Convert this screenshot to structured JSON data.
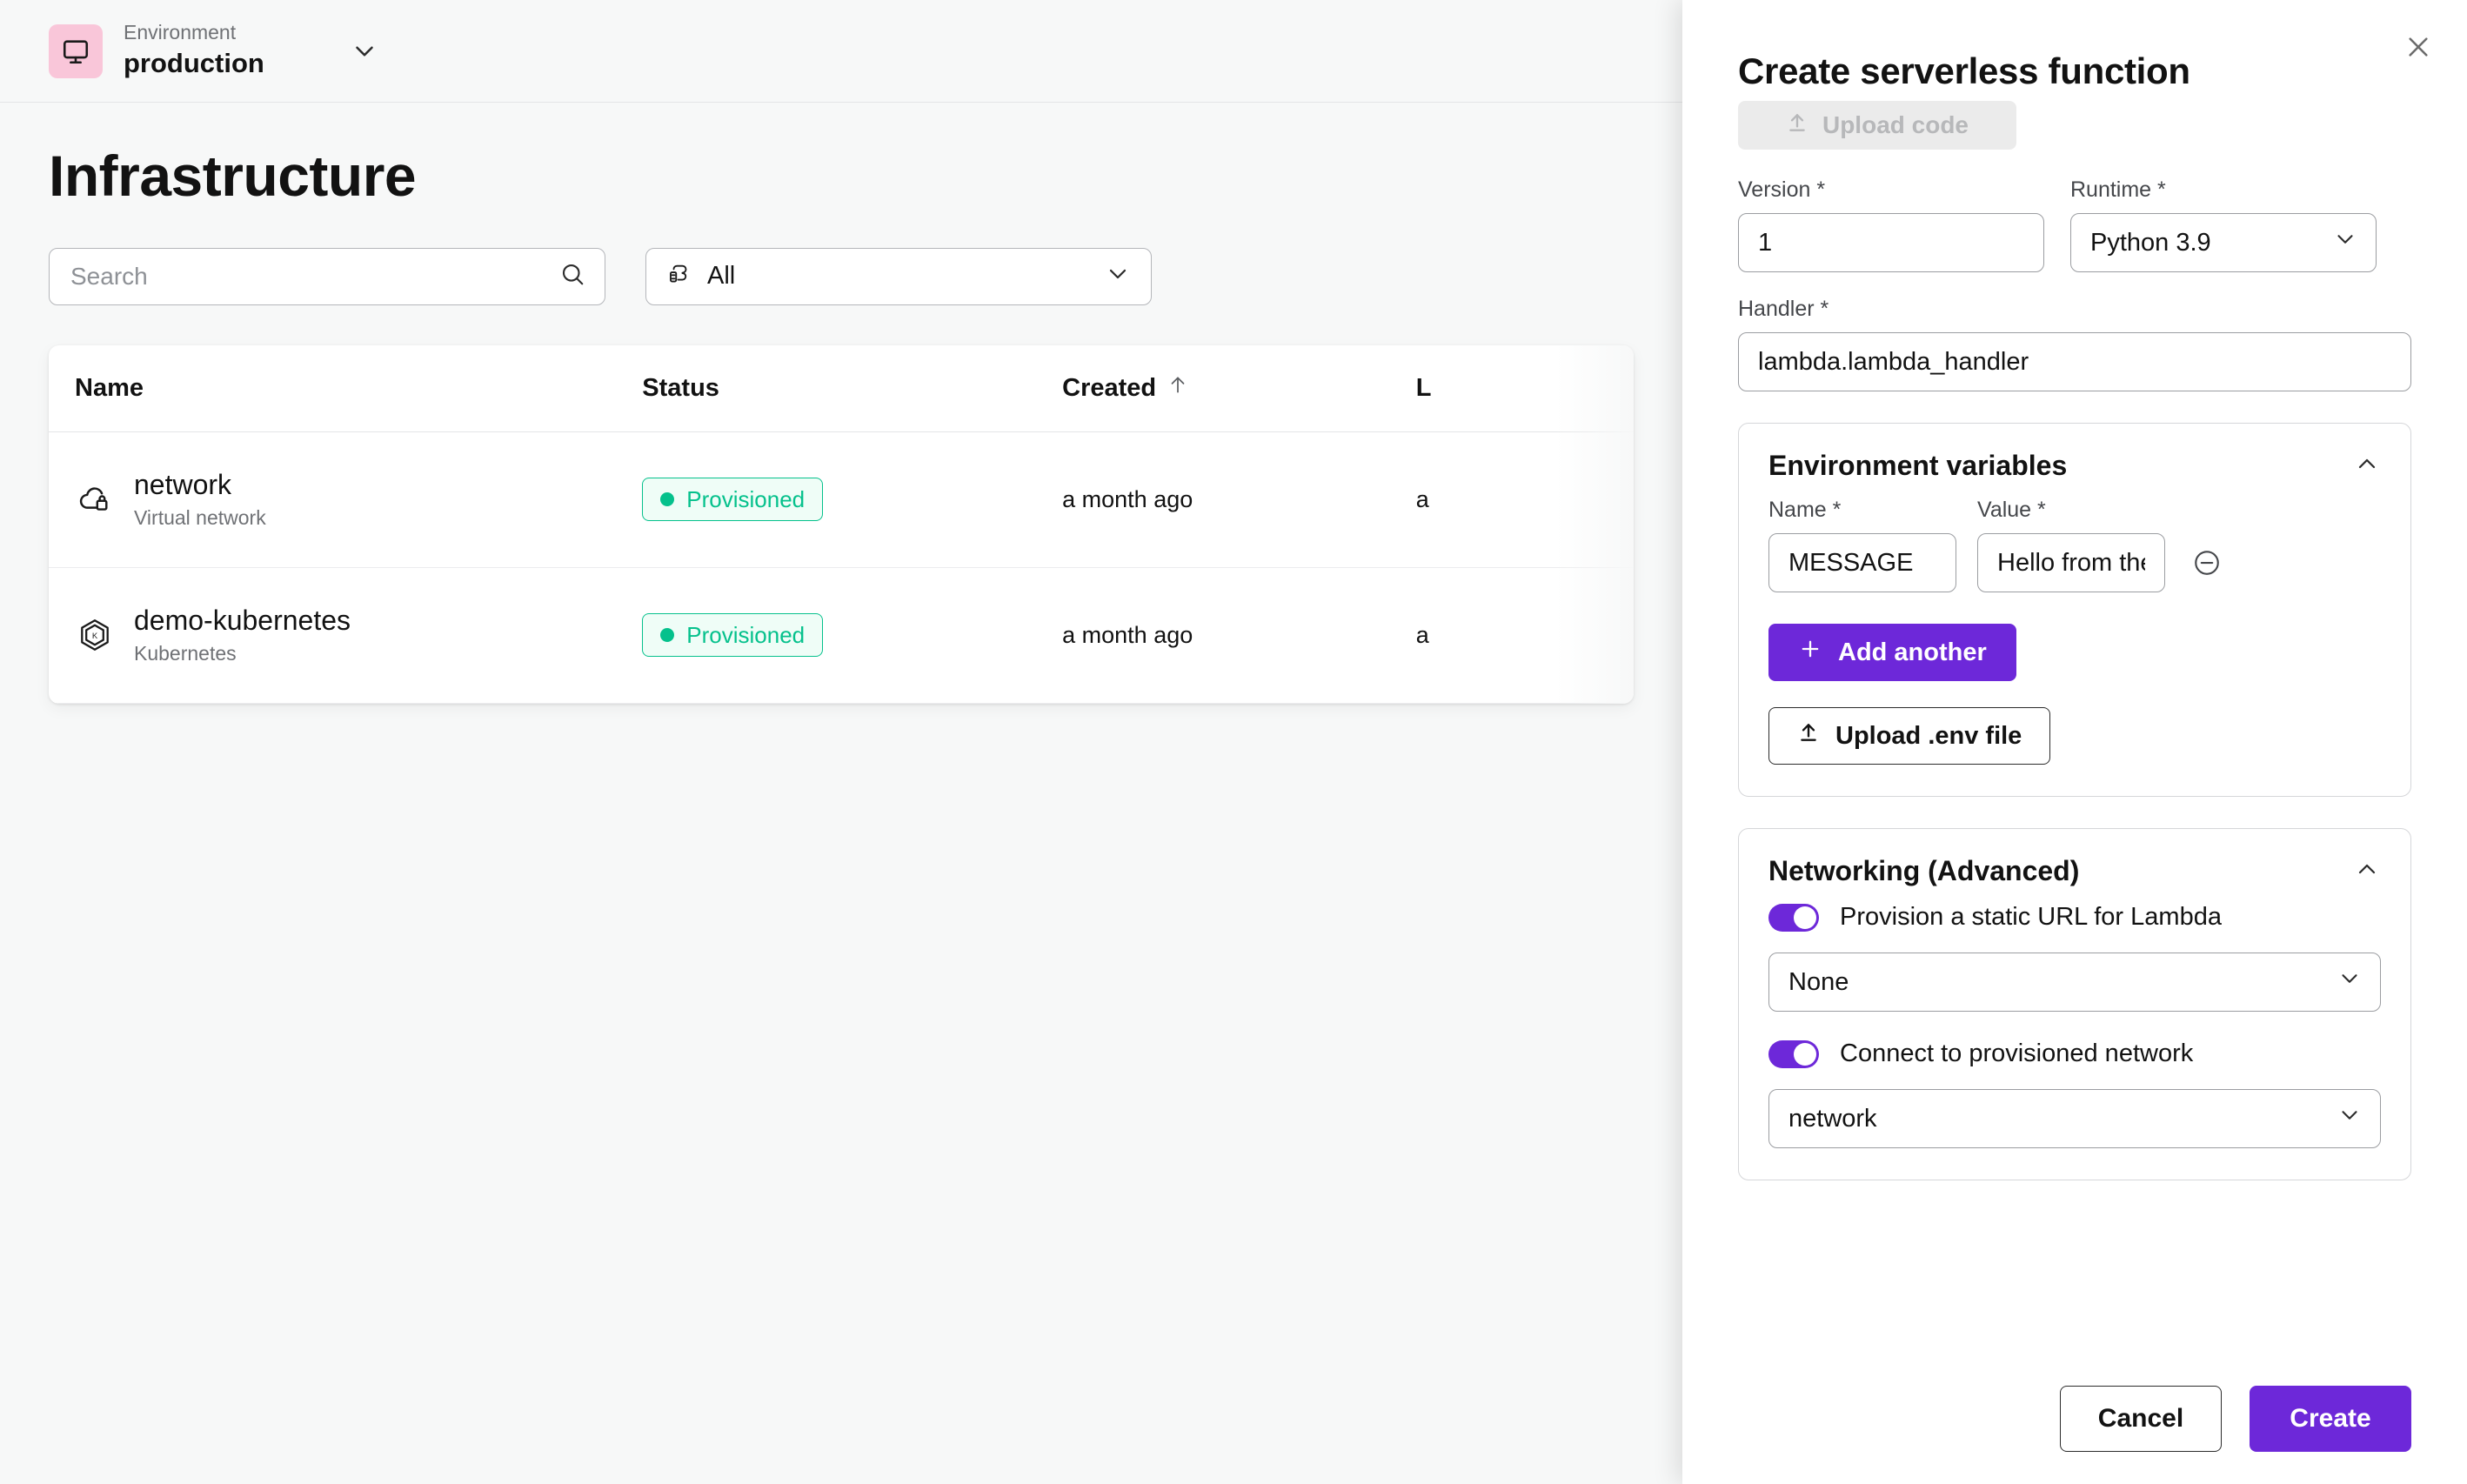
{
  "topbar": {
    "env_label": "Environment",
    "env_value": "production",
    "env_icon": "monitor-icon",
    "caret_icon": "chevron-down-icon"
  },
  "main": {
    "page_title": "Infrastructure",
    "search": {
      "value": "",
      "placeholder": "Search",
      "icon": "search-icon"
    },
    "filter": {
      "value": "All",
      "icon": "resource-cloud-icon",
      "caret": "chevron-down-icon"
    },
    "table": {
      "columns": [
        {
          "key": "name",
          "label": "Name"
        },
        {
          "key": "status",
          "label": "Status"
        },
        {
          "key": "created",
          "label": "Created",
          "sort": "ascending",
          "sort_icon": "arrow-up-icon"
        },
        {
          "key": "last",
          "label": "L"
        }
      ],
      "rows": [
        {
          "icon": "cloud-lock-icon",
          "name": "network",
          "subtitle": "Virtual network",
          "status": "Provisioned",
          "created": "a month ago",
          "last": "a"
        },
        {
          "icon": "kubernetes-icon",
          "name": "demo-kubernetes",
          "subtitle": "Kubernetes",
          "status": "Provisioned",
          "created": "a month ago",
          "last": "a"
        }
      ]
    }
  },
  "panel": {
    "title": "Create serverless function",
    "close_icon": "close-icon",
    "upload_code": {
      "label": "Upload code",
      "icon": "upload-icon",
      "disabled": true
    },
    "version": {
      "label": "Version *",
      "value": "1"
    },
    "runtime": {
      "label": "Runtime *",
      "value": "Python 3.9",
      "caret": "chevron-down-icon"
    },
    "handler": {
      "label": "Handler *",
      "value": "lambda.lambda_handler"
    },
    "env_vars": {
      "title": "Environment variables",
      "collapse_icon": "chevron-up-icon",
      "name_label": "Name *",
      "value_label": "Value *",
      "rows": [
        {
          "name": "MESSAGE",
          "value": "Hello from the Kap",
          "remove_icon": "minus-circle-icon"
        }
      ],
      "add_another": {
        "label": "Add another",
        "icon": "plus-icon"
      },
      "upload_env": {
        "label": "Upload .env file",
        "icon": "upload-icon"
      }
    },
    "networking": {
      "title": "Networking (Advanced)",
      "collapse_icon": "chevron-up-icon",
      "static_url": {
        "label": "Provision a static URL for Lambda",
        "on": true,
        "select_value": "None",
        "caret": "chevron-down-icon"
      },
      "connect_network": {
        "label": "Connect to provisioned network",
        "on": true,
        "select_value": "network",
        "caret": "chevron-down-icon"
      }
    },
    "footer": {
      "cancel": "Cancel",
      "create": "Create"
    }
  },
  "colors": {
    "accent": "#6d28d9",
    "success": "#05c18c",
    "success_bg": "#effdf7",
    "env_icon_bg": "#f9c6d9",
    "page_bg": "#f7f8f8"
  }
}
